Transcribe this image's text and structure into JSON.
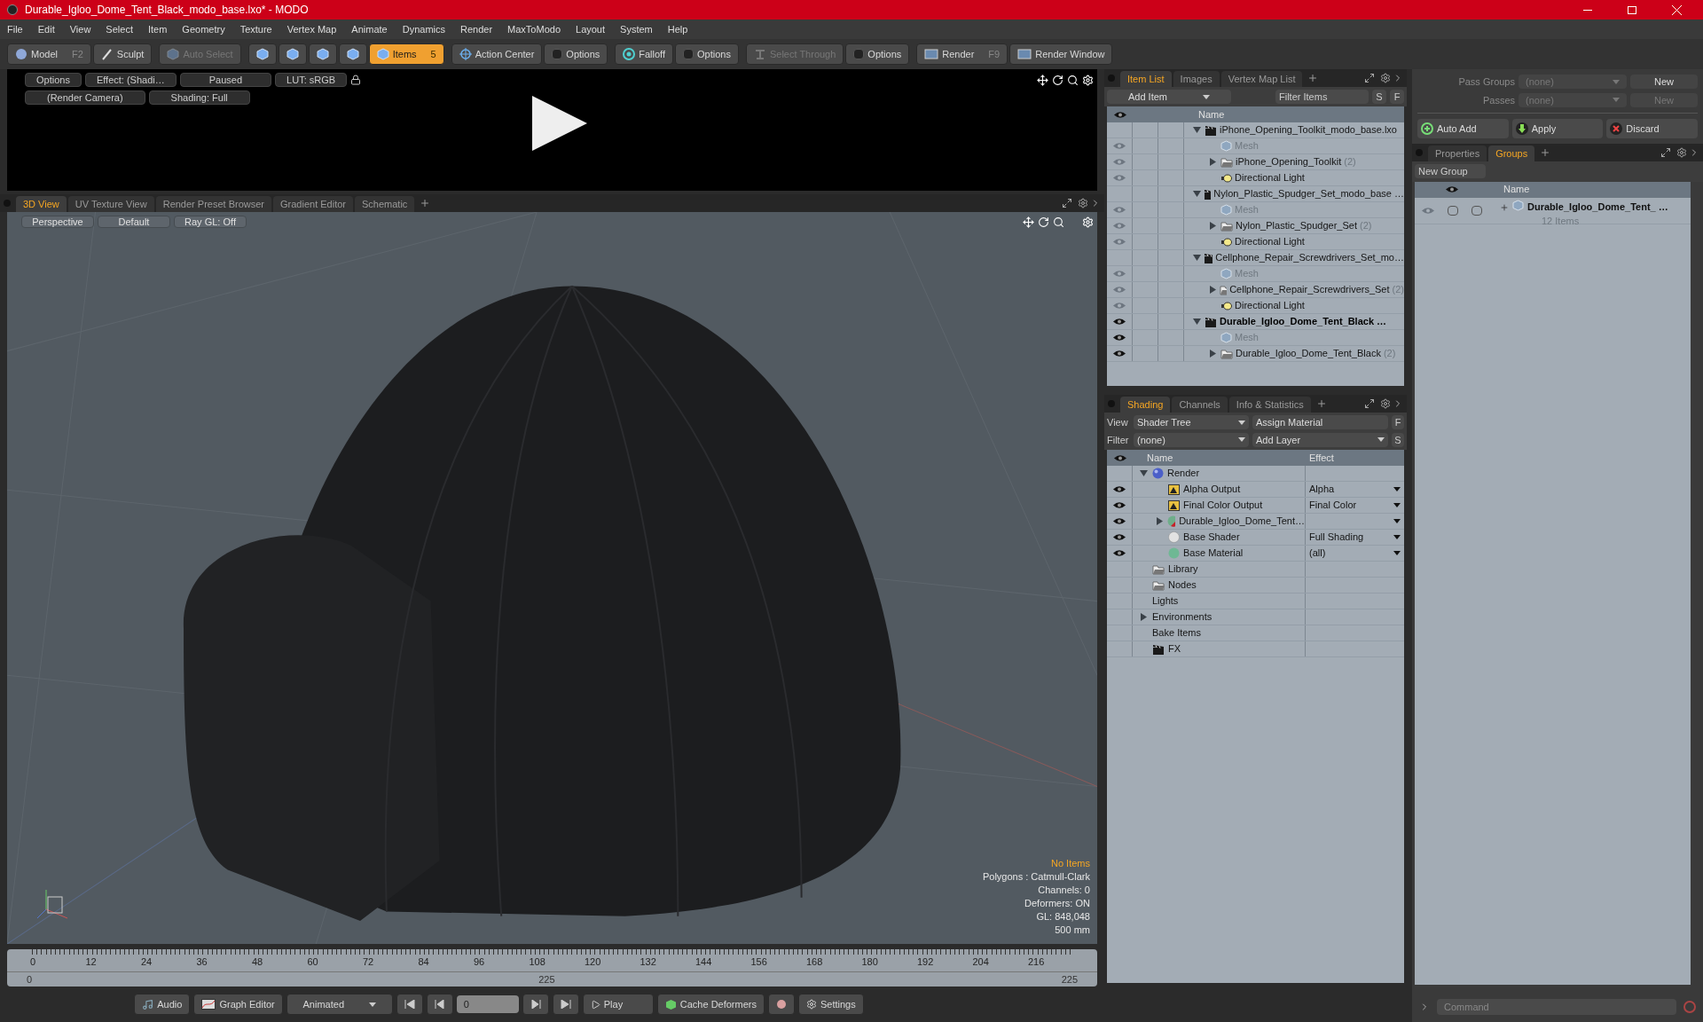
{
  "window": {
    "title": "Durable_Igloo_Dome_Tent_Black_modo_base.lxo* - MODO"
  },
  "menu": [
    "File",
    "Edit",
    "View",
    "Select",
    "Item",
    "Geometry",
    "Texture",
    "Vertex Map",
    "Animate",
    "Dynamics",
    "Render",
    "MaxToModo",
    "Layout",
    "System",
    "Help"
  ],
  "toolbar": [
    {
      "items": [
        {
          "kind": "sphere",
          "label": "Model",
          "shortcut": "F2",
          "selected": false,
          "disabled": false
        },
        {
          "kind": "brush",
          "label": "Sculpt",
          "selected": false,
          "disabled": false
        }
      ]
    },
    {
      "items": [
        {
          "kind": "cube",
          "label": "Auto Select",
          "selected": false,
          "disabled": true
        }
      ]
    },
    {
      "items": [
        {
          "kind": "cube",
          "selected": false,
          "disabled": false
        },
        {
          "kind": "cube",
          "selected": false,
          "disabled": false
        },
        {
          "kind": "cube",
          "selected": false,
          "disabled": false
        },
        {
          "kind": "cube",
          "selected": false,
          "disabled": false
        },
        {
          "kind": "cube",
          "label": "Items",
          "shortcut": "5",
          "selected": true,
          "disabled": false
        }
      ]
    },
    {
      "items": [
        {
          "kind": "target",
          "label": "Action Center",
          "selected": false,
          "disabled": false
        },
        {
          "kind": "box",
          "label": "Options",
          "selected": false,
          "disabled": false
        }
      ]
    },
    {
      "items": [
        {
          "kind": "falloff",
          "label": "Falloff",
          "selected": false,
          "disabled": false
        },
        {
          "kind": "box",
          "label": "Options",
          "selected": false,
          "disabled": false
        }
      ]
    },
    {
      "items": [
        {
          "kind": "through",
          "label": "Select Through",
          "selected": false,
          "disabled": true
        },
        {
          "kind": "box",
          "label": "Options",
          "selected": false,
          "disabled": false
        }
      ]
    },
    {
      "items": [
        {
          "kind": "render",
          "label": "Render",
          "shortcut": "F9",
          "selected": false,
          "disabled": false
        },
        {
          "kind": "render",
          "label": "Render Window",
          "selected": false,
          "disabled": false
        }
      ]
    }
  ],
  "preview": {
    "row_1": [
      "Options",
      "Effect: (Shadi…",
      "Paused",
      "LUT: sRGB"
    ],
    "row_2": [
      "(Render Camera)",
      "Shading: Full"
    ]
  },
  "viewport": {
    "tabs": [
      {
        "label": "3D View",
        "selected": true
      },
      {
        "label": "UV Texture View",
        "selected": false
      },
      {
        "label": "Render Preset Browser",
        "selected": false
      },
      {
        "label": "Gradient Editor",
        "selected": false
      },
      {
        "label": "Schematic",
        "selected": false
      }
    ],
    "buttons": [
      "Perspective",
      "Default",
      "Ray GL: Off"
    ],
    "info": [
      {
        "kind": "warning",
        "text": "No Items"
      },
      {
        "kind": "normal",
        "text": "Polygons : Catmull-Clark"
      },
      {
        "kind": "normal",
        "text": "Channels: 0"
      },
      {
        "kind": "normal",
        "text": "Deformers: ON"
      },
      {
        "kind": "normal",
        "text": "GL: 848,048"
      },
      {
        "kind": "normal",
        "text": "500 mm"
      }
    ]
  },
  "timeline": {
    "ticks": [
      "0",
      "12",
      "24",
      "36",
      "48",
      "60",
      "72",
      "84",
      "96",
      "108",
      "120",
      "132",
      "144",
      "156",
      "168",
      "180",
      "192",
      "204",
      "216"
    ],
    "start": "0",
    "middle": "225",
    "end": "225"
  },
  "transport": {
    "audio": "Audio",
    "graph_editor": "Graph Editor",
    "mode": "Animated",
    "frame": "0",
    "play": "Play",
    "cache": "Cache Deformers",
    "settings": "Settings"
  },
  "item_list": {
    "tabs": [
      {
        "label": "Item List",
        "selected": true
      },
      {
        "label": "Images",
        "selected": false
      },
      {
        "label": "Vertex Map List",
        "selected": false
      }
    ],
    "add_item": "Add Item",
    "filter": {
      "placeholder": "Filter Items"
    },
    "buttons": [
      "S",
      "F"
    ],
    "column": "Name",
    "rows": [
      {
        "kind": "scene",
        "label": "iPhone_Opening_Toolkit_modo_base.lxo",
        "visible": false,
        "active": false,
        "expanded": true,
        "children": [
          {
            "kind": "mesh",
            "label": "Mesh",
            "visible": true
          },
          {
            "kind": "group",
            "label": "iPhone_Opening_Toolkit",
            "count": "(2)",
            "visible": true,
            "expanded": false
          },
          {
            "kind": "light",
            "label": "Directional Light",
            "visible": true
          }
        ]
      },
      {
        "kind": "scene",
        "label": "Nylon_Plastic_Spudger_Set_modo_base …",
        "visible": false,
        "active": false,
        "expanded": true,
        "children": [
          {
            "kind": "mesh",
            "label": "Mesh",
            "visible": true
          },
          {
            "kind": "group",
            "label": "Nylon_Plastic_Spudger_Set",
            "count": "(2)",
            "visible": true,
            "expanded": false
          },
          {
            "kind": "light",
            "label": "Directional Light",
            "visible": true
          }
        ]
      },
      {
        "kind": "scene",
        "label": "Cellphone_Repair_Screwdrivers_Set_mo…",
        "visible": false,
        "active": false,
        "expanded": true,
        "children": [
          {
            "kind": "mesh",
            "label": "Mesh",
            "visible": true
          },
          {
            "kind": "group",
            "label": "Cellphone_Repair_Screwdrivers_Set",
            "count": "(2)",
            "visible": true,
            "expanded": false
          },
          {
            "kind": "light",
            "label": "Directional Light",
            "visible": true
          }
        ]
      },
      {
        "kind": "scene",
        "label": "Durable_Igloo_Dome_Tent_Black …",
        "visible": true,
        "active": true,
        "expanded": true,
        "children": [
          {
            "kind": "mesh",
            "label": "Mesh",
            "visible": true
          },
          {
            "kind": "group",
            "label": "Durable_Igloo_Dome_Tent_Black",
            "count": "(2)",
            "visible": true,
            "expanded": false
          }
        ]
      }
    ]
  },
  "shading": {
    "tabs": [
      {
        "label": "Shading",
        "selected": true
      },
      {
        "label": "Channels",
        "selected": false
      },
      {
        "label": "Info & Statistics",
        "selected": false
      }
    ],
    "view_label": "View",
    "view": "Shader Tree",
    "assign": "Assign Material",
    "assign_button": "F",
    "filter_label": "Filter",
    "filter": "(none)",
    "add_layer": "Add Layer",
    "add_button": "S",
    "columns": [
      "Name",
      "Effect"
    ],
    "rows": [
      {
        "kind": "render",
        "label": "Render",
        "visible": false,
        "expanded": true,
        "children": [
          {
            "kind": "output",
            "label": "Alpha Output",
            "effect": "Alpha",
            "visible": true
          },
          {
            "kind": "output",
            "label": "Final Color Output",
            "effect": "Final Color",
            "visible": true
          },
          {
            "kind": "material",
            "label": "Durable_Igloo_Dome_Tent…",
            "visible": true,
            "expanded": false
          },
          {
            "kind": "shader",
            "label": "Base Shader",
            "effect": "Full Shading",
            "visible": true
          },
          {
            "kind": "base_material",
            "label": "Base Material",
            "effect": "(all)",
            "visible": true
          }
        ]
      },
      {
        "kind": "folder",
        "label": "Library",
        "visible": false
      },
      {
        "kind": "folder",
        "label": "Nodes",
        "visible": false
      },
      {
        "kind": "none",
        "label": "Lights",
        "visible": false
      },
      {
        "kind": "none",
        "label": "Environments",
        "visible": false,
        "expanded": false
      },
      {
        "kind": "none",
        "label": "Bake Items",
        "visible": false
      },
      {
        "kind": "fx",
        "label": "FX",
        "visible": false
      }
    ]
  },
  "passes": [
    {
      "label": "Pass Groups",
      "value": "(none)",
      "button": "New",
      "disabled": false
    },
    {
      "label": "Passes",
      "value": "(none)",
      "button": "New",
      "disabled": true
    }
  ],
  "actions": [
    {
      "kind": "add",
      "label": "Auto Add"
    },
    {
      "kind": "apply",
      "label": "Apply"
    },
    {
      "kind": "discard",
      "label": "Discard"
    }
  ],
  "groups": {
    "tabs": [
      {
        "label": "Properties",
        "selected": false
      },
      {
        "label": "Groups",
        "selected": true
      }
    ],
    "new_group": "New Group",
    "column": "Name",
    "rows": [
      {
        "label": "Durable_Igloo_Dome_Tent_ …",
        "count": "12 Items",
        "toggles": [
          {
            "checked": false
          },
          {
            "checked": false
          }
        ]
      }
    ]
  },
  "command": {
    "placeholder": "Command"
  }
}
